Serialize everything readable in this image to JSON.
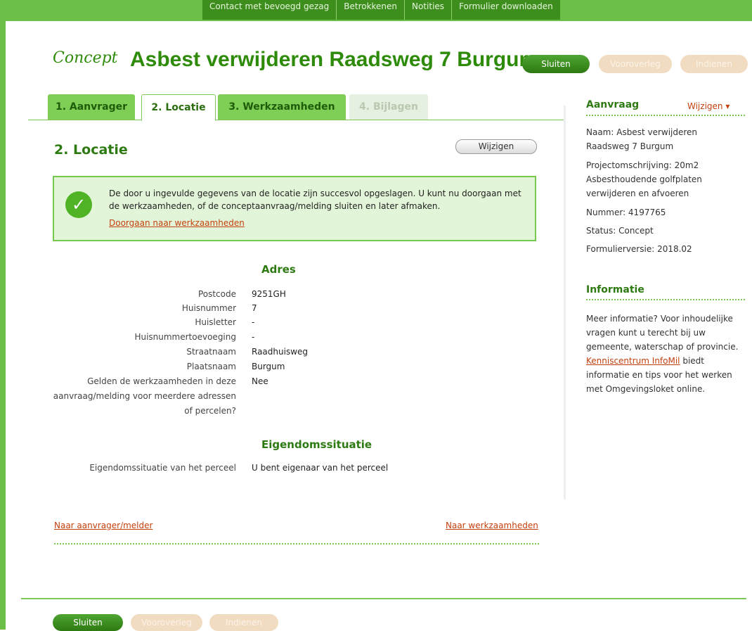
{
  "top_nav": [
    "Contact met bevoegd gezag",
    "Betrokkenen",
    "Notities",
    "Formulier downloaden"
  ],
  "header": {
    "concept": "Concept",
    "title": "Asbest verwijderen Raadsweg 7 Burgum",
    "buttons": {
      "sluiten": "Sluiten",
      "vooroverleg": "Vooroverleg",
      "indienen": "Indienen"
    }
  },
  "tabs": [
    "1. Aanvrager",
    "2. Locatie",
    "3. Werkzaamheden",
    "4. Bijlagen"
  ],
  "section": {
    "title": "2. Locatie",
    "edit": "Wijzigen"
  },
  "notice": {
    "text": "De door u ingevulde gegevens van de locatie zijn succesvol opgeslagen. U kunt nu doorgaan met de werkzaamheden, of de conceptaanvraag/melding sluiten en later afmaken.",
    "link": "Doorgaan naar werkzaamheden"
  },
  "adres": {
    "heading": "Adres",
    "rows": [
      {
        "label": "Postcode",
        "value": "9251GH"
      },
      {
        "label": "Huisnummer",
        "value": "7"
      },
      {
        "label": "Huisletter",
        "value": "-"
      },
      {
        "label": "Huisnummertoevoeging",
        "value": "-"
      },
      {
        "label": "Straatnaam",
        "value": "Raadhuisweg"
      },
      {
        "label": "Plaatsnaam",
        "value": "Burgum"
      },
      {
        "label": "Gelden de werkzaamheden in deze",
        "value": "Nee"
      },
      {
        "label": "aanvraag/melding voor meerdere adressen",
        "value": ""
      },
      {
        "label": "of percelen?",
        "value": ""
      }
    ]
  },
  "eigendom": {
    "heading": "Eigendomssituatie",
    "label": "Eigendomssituatie van het perceel",
    "value": "U bent eigenaar van het perceel"
  },
  "nav_links": {
    "prev": "Naar aanvrager/melder",
    "next": "Naar werkzaamheden"
  },
  "sidebar": {
    "aanvraag_heading": "Aanvraag",
    "wijzigen": "Wijzigen ▾",
    "lines": [
      "Naam: Asbest verwijderen",
      "Raadsweg 7 Burgum",
      "Projectomschrijving: 20m2",
      "Asbesthoudende golfplaten",
      "verwijderen en afvoeren",
      "Nummer: 4197765",
      "Status: Concept",
      "Formulierversie: 2018.02"
    ],
    "info_heading": "Informatie",
    "info_lines": [
      "Meer informatie? Voor inhoudelijke",
      "vragen kunt u terecht bij uw",
      "gemeente, waterschap of provincie."
    ],
    "info_link": "Kenniscentrum InfoMil",
    "info_after": [
      " biedt",
      "informatie en tips voor het werken",
      "met Omgevingsloket online."
    ]
  },
  "footer_buttons": {
    "sluiten": "Sluiten",
    "vooroverleg": "Vooroverleg",
    "indienen": "Indienen"
  }
}
